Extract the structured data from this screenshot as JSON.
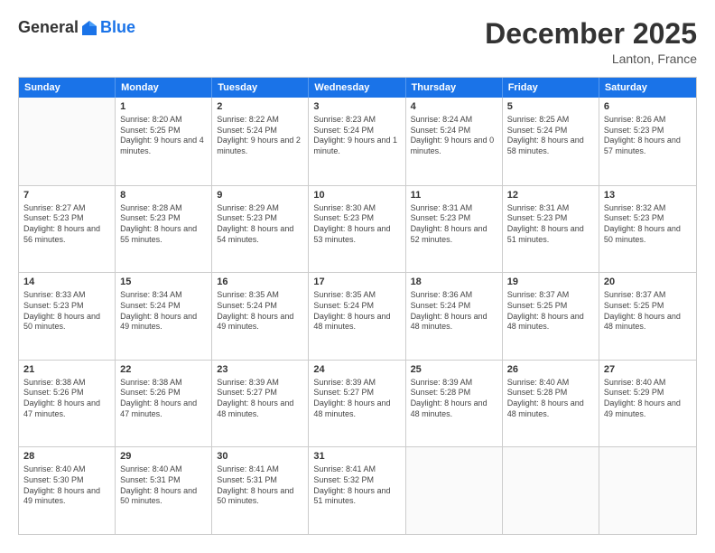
{
  "logo": {
    "general": "General",
    "blue": "Blue"
  },
  "header": {
    "month": "December 2025",
    "location": "Lanton, France"
  },
  "weekdays": [
    "Sunday",
    "Monday",
    "Tuesday",
    "Wednesday",
    "Thursday",
    "Friday",
    "Saturday"
  ],
  "rows": [
    [
      {
        "day": "",
        "empty": true
      },
      {
        "day": "1",
        "sunrise": "Sunrise: 8:20 AM",
        "sunset": "Sunset: 5:25 PM",
        "daylight": "Daylight: 9 hours and 4 minutes."
      },
      {
        "day": "2",
        "sunrise": "Sunrise: 8:22 AM",
        "sunset": "Sunset: 5:24 PM",
        "daylight": "Daylight: 9 hours and 2 minutes."
      },
      {
        "day": "3",
        "sunrise": "Sunrise: 8:23 AM",
        "sunset": "Sunset: 5:24 PM",
        "daylight": "Daylight: 9 hours and 1 minute."
      },
      {
        "day": "4",
        "sunrise": "Sunrise: 8:24 AM",
        "sunset": "Sunset: 5:24 PM",
        "daylight": "Daylight: 9 hours and 0 minutes."
      },
      {
        "day": "5",
        "sunrise": "Sunrise: 8:25 AM",
        "sunset": "Sunset: 5:24 PM",
        "daylight": "Daylight: 8 hours and 58 minutes."
      },
      {
        "day": "6",
        "sunrise": "Sunrise: 8:26 AM",
        "sunset": "Sunset: 5:23 PM",
        "daylight": "Daylight: 8 hours and 57 minutes."
      }
    ],
    [
      {
        "day": "7",
        "sunrise": "Sunrise: 8:27 AM",
        "sunset": "Sunset: 5:23 PM",
        "daylight": "Daylight: 8 hours and 56 minutes."
      },
      {
        "day": "8",
        "sunrise": "Sunrise: 8:28 AM",
        "sunset": "Sunset: 5:23 PM",
        "daylight": "Daylight: 8 hours and 55 minutes."
      },
      {
        "day": "9",
        "sunrise": "Sunrise: 8:29 AM",
        "sunset": "Sunset: 5:23 PM",
        "daylight": "Daylight: 8 hours and 54 minutes."
      },
      {
        "day": "10",
        "sunrise": "Sunrise: 8:30 AM",
        "sunset": "Sunset: 5:23 PM",
        "daylight": "Daylight: 8 hours and 53 minutes."
      },
      {
        "day": "11",
        "sunrise": "Sunrise: 8:31 AM",
        "sunset": "Sunset: 5:23 PM",
        "daylight": "Daylight: 8 hours and 52 minutes."
      },
      {
        "day": "12",
        "sunrise": "Sunrise: 8:31 AM",
        "sunset": "Sunset: 5:23 PM",
        "daylight": "Daylight: 8 hours and 51 minutes."
      },
      {
        "day": "13",
        "sunrise": "Sunrise: 8:32 AM",
        "sunset": "Sunset: 5:23 PM",
        "daylight": "Daylight: 8 hours and 50 minutes."
      }
    ],
    [
      {
        "day": "14",
        "sunrise": "Sunrise: 8:33 AM",
        "sunset": "Sunset: 5:23 PM",
        "daylight": "Daylight: 8 hours and 50 minutes."
      },
      {
        "day": "15",
        "sunrise": "Sunrise: 8:34 AM",
        "sunset": "Sunset: 5:24 PM",
        "daylight": "Daylight: 8 hours and 49 minutes."
      },
      {
        "day": "16",
        "sunrise": "Sunrise: 8:35 AM",
        "sunset": "Sunset: 5:24 PM",
        "daylight": "Daylight: 8 hours and 49 minutes."
      },
      {
        "day": "17",
        "sunrise": "Sunrise: 8:35 AM",
        "sunset": "Sunset: 5:24 PM",
        "daylight": "Daylight: 8 hours and 48 minutes."
      },
      {
        "day": "18",
        "sunrise": "Sunrise: 8:36 AM",
        "sunset": "Sunset: 5:24 PM",
        "daylight": "Daylight: 8 hours and 48 minutes."
      },
      {
        "day": "19",
        "sunrise": "Sunrise: 8:37 AM",
        "sunset": "Sunset: 5:25 PM",
        "daylight": "Daylight: 8 hours and 48 minutes."
      },
      {
        "day": "20",
        "sunrise": "Sunrise: 8:37 AM",
        "sunset": "Sunset: 5:25 PM",
        "daylight": "Daylight: 8 hours and 48 minutes."
      }
    ],
    [
      {
        "day": "21",
        "sunrise": "Sunrise: 8:38 AM",
        "sunset": "Sunset: 5:26 PM",
        "daylight": "Daylight: 8 hours and 47 minutes."
      },
      {
        "day": "22",
        "sunrise": "Sunrise: 8:38 AM",
        "sunset": "Sunset: 5:26 PM",
        "daylight": "Daylight: 8 hours and 47 minutes."
      },
      {
        "day": "23",
        "sunrise": "Sunrise: 8:39 AM",
        "sunset": "Sunset: 5:27 PM",
        "daylight": "Daylight: 8 hours and 48 minutes."
      },
      {
        "day": "24",
        "sunrise": "Sunrise: 8:39 AM",
        "sunset": "Sunset: 5:27 PM",
        "daylight": "Daylight: 8 hours and 48 minutes."
      },
      {
        "day": "25",
        "sunrise": "Sunrise: 8:39 AM",
        "sunset": "Sunset: 5:28 PM",
        "daylight": "Daylight: 8 hours and 48 minutes."
      },
      {
        "day": "26",
        "sunrise": "Sunrise: 8:40 AM",
        "sunset": "Sunset: 5:28 PM",
        "daylight": "Daylight: 8 hours and 48 minutes."
      },
      {
        "day": "27",
        "sunrise": "Sunrise: 8:40 AM",
        "sunset": "Sunset: 5:29 PM",
        "daylight": "Daylight: 8 hours and 49 minutes."
      }
    ],
    [
      {
        "day": "28",
        "sunrise": "Sunrise: 8:40 AM",
        "sunset": "Sunset: 5:30 PM",
        "daylight": "Daylight: 8 hours and 49 minutes."
      },
      {
        "day": "29",
        "sunrise": "Sunrise: 8:40 AM",
        "sunset": "Sunset: 5:31 PM",
        "daylight": "Daylight: 8 hours and 50 minutes."
      },
      {
        "day": "30",
        "sunrise": "Sunrise: 8:41 AM",
        "sunset": "Sunset: 5:31 PM",
        "daylight": "Daylight: 8 hours and 50 minutes."
      },
      {
        "day": "31",
        "sunrise": "Sunrise: 8:41 AM",
        "sunset": "Sunset: 5:32 PM",
        "daylight": "Daylight: 8 hours and 51 minutes."
      },
      {
        "day": "",
        "empty": true
      },
      {
        "day": "",
        "empty": true
      },
      {
        "day": "",
        "empty": true
      }
    ]
  ]
}
